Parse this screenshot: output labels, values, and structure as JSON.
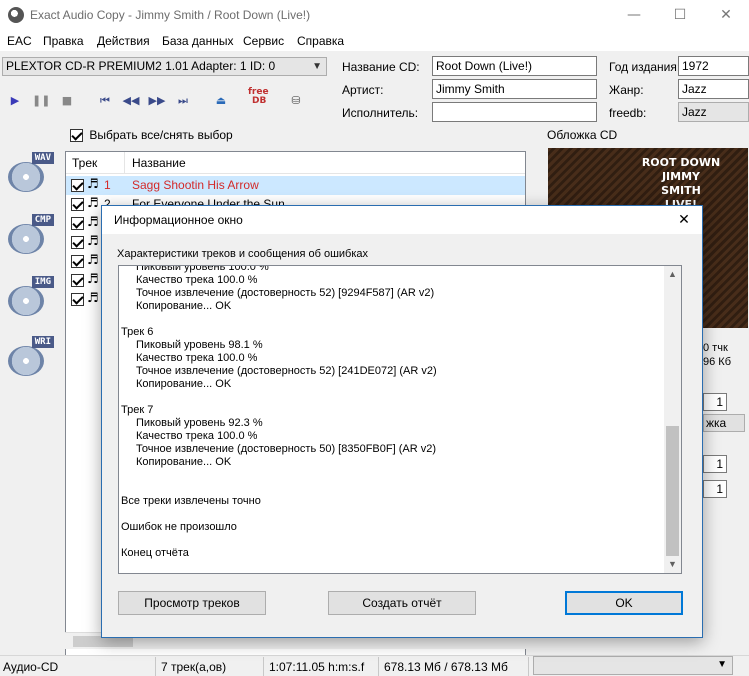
{
  "window": {
    "title": "Exact Audio Copy    -    Jimmy Smith / Root Down (Live!)",
    "controls": {
      "minimize": "—",
      "maximize": "☐",
      "close": "✕"
    }
  },
  "menu": [
    "EAC",
    "Правка",
    "Действия",
    "База данных",
    "Сервис",
    "Справка"
  ],
  "drive": {
    "selected": "PLEXTOR CD-R   PREMIUM2 1.01   Adapter: 1  ID: 0"
  },
  "toolbar": {
    "icons": [
      "play-icon",
      "pause-icon",
      "stop-icon",
      "first-track-icon",
      "rewind-icon",
      "forward-icon",
      "last-track-icon",
      "eject-icon",
      "freedb-icon",
      "network-icon"
    ],
    "freedb_text": [
      "free",
      "DB"
    ]
  },
  "cd_info": {
    "title_label": "Название CD:",
    "title_value": "Root Down (Live!)",
    "artist_label": "Артист:",
    "artist_value": "Jimmy Smith",
    "performer_label": "Исполнитель:",
    "performer_value": "",
    "year_label": "Год издания:",
    "year_value": "1972",
    "genre_label": "Жанр:",
    "genre_value": "Jazz",
    "freedb_label": "freedb:",
    "freedb_value": "Jazz"
  },
  "select_all_label": "Выбрать все/снять выбор",
  "tracklist": {
    "headers": {
      "track": "Трек",
      "name": "Название"
    },
    "rows": [
      {
        "num": "1",
        "name": "Sagg Shootin His Arrow"
      },
      {
        "num": "2",
        "name": "For Everyone Under the Sun"
      },
      {
        "num": "",
        "name": ""
      },
      {
        "num": "",
        "name": ""
      },
      {
        "num": "",
        "name": ""
      },
      {
        "num": "",
        "name": ""
      },
      {
        "num": "",
        "name": ""
      }
    ]
  },
  "side_icons": [
    "WAV",
    "CMP",
    "IMG",
    "WRI"
  ],
  "cover": {
    "label": "Обложка CD",
    "art_text": [
      "ROOT DOWN",
      "JIMMY",
      "SMITH",
      "LIVE!"
    ],
    "info_tail_1": "0 тчк",
    "info_tail_2": "96 Кб",
    "field_a": "1",
    "button_tail": "жка",
    "field_b": "1",
    "field_c": "1"
  },
  "status": {
    "type": "Аудио-CD",
    "tracks": "7 трек(а,ов)",
    "length": "1:07:11.05 h:m:s.f",
    "size": "678.13 Мб / 678.13 Мб"
  },
  "dialog": {
    "title": "Информационное окно",
    "close": "✕",
    "caption": "Характеристики треков и сообщения об ошибках",
    "log": [
      {
        "text": "Пиковый уровень 100.0 %",
        "indent": true
      },
      {
        "text": "Качество трека 100.0 %",
        "indent": true
      },
      {
        "text": "Точное извлечение (достоверность 52)  [9294F587]  (AR v2)",
        "indent": true
      },
      {
        "text": "Копирование... OK",
        "indent": true
      },
      {
        "text": "",
        "indent": false
      },
      {
        "text": "Трек  6",
        "indent": false
      },
      {
        "text": "Пиковый уровень 98.1 %",
        "indent": true
      },
      {
        "text": "Качество трека 100.0 %",
        "indent": true
      },
      {
        "text": "Точное извлечение (достоверность 52)  [241DE072]  (AR v2)",
        "indent": true
      },
      {
        "text": "Копирование... OK",
        "indent": true
      },
      {
        "text": "",
        "indent": false
      },
      {
        "text": "Трек  7",
        "indent": false
      },
      {
        "text": "Пиковый уровень 92.3 %",
        "indent": true
      },
      {
        "text": "Качество трека 100.0 %",
        "indent": true
      },
      {
        "text": "Точное извлечение (достоверность 50)  [8350FB0F]  (AR v2)",
        "indent": true
      },
      {
        "text": "Копирование... OK",
        "indent": true
      },
      {
        "text": "",
        "indent": false
      },
      {
        "text": "",
        "indent": false
      },
      {
        "text": "Все треки извлечены точно",
        "indent": false
      },
      {
        "text": "",
        "indent": false
      },
      {
        "text": "Ошибок не произошло",
        "indent": false
      },
      {
        "text": "",
        "indent": false
      },
      {
        "text": "Конец отчёта",
        "indent": false
      }
    ],
    "buttons": {
      "view": "Просмотр треков",
      "create": "Создать отчёт",
      "ok": "OK"
    }
  }
}
